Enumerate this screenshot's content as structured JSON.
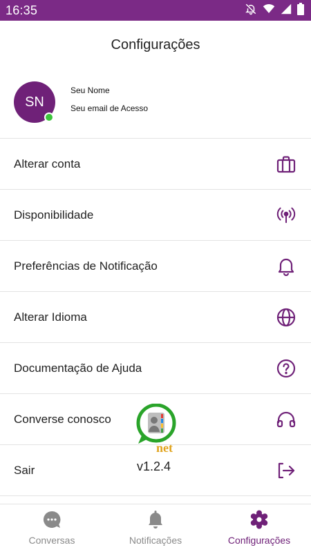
{
  "status_bar": {
    "time": "16:35",
    "icons": [
      "notifications-off-icon",
      "wifi-icon",
      "signal-icon",
      "battery-icon"
    ]
  },
  "header": {
    "title": "Configurações"
  },
  "profile": {
    "initials": "SN",
    "name": "Seu Nome",
    "email": "Seu email de Acesso",
    "status_color": "#3cc43c"
  },
  "menu": {
    "items": [
      {
        "label": "Alterar conta",
        "icon": "briefcase-icon"
      },
      {
        "label": "Disponibilidade",
        "icon": "broadcast-icon"
      },
      {
        "label": "Preferências de Notificação",
        "icon": "bell-icon"
      },
      {
        "label": "Alterar Idioma",
        "icon": "globe-icon"
      },
      {
        "label": "Documentação de Ajuda",
        "icon": "help-circle-icon"
      },
      {
        "label": "Converse conosco",
        "icon": "headphones-icon"
      },
      {
        "label": "Sair",
        "icon": "logout-icon"
      }
    ]
  },
  "watermark": {
    "text": "net"
  },
  "version": "v1.2.4",
  "bottom_nav": {
    "items": [
      {
        "label": "Conversas",
        "icon": "chat-bubble-icon"
      },
      {
        "label": "Notificações",
        "icon": "bell-icon"
      },
      {
        "label": "Configurações",
        "icon": "gear-icon"
      }
    ],
    "active_index": 2
  },
  "colors": {
    "accent": "#6f2178",
    "status_bar": "#7b2a86",
    "inactive": "#8a8a8a"
  }
}
